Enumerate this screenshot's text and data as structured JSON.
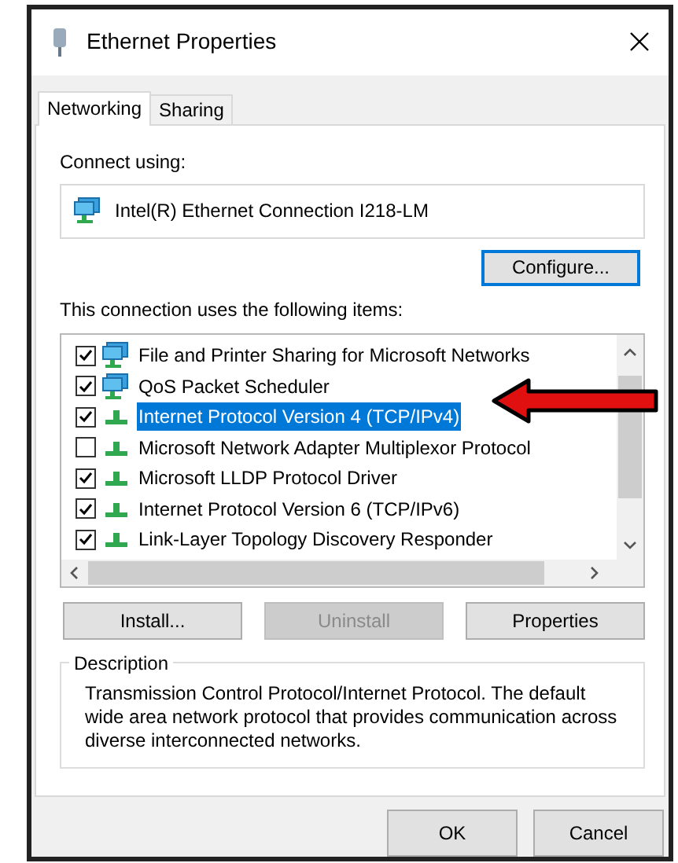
{
  "window": {
    "title": "Ethernet Properties"
  },
  "tabs": [
    {
      "label": "Networking",
      "selected": true
    },
    {
      "label": "Sharing",
      "selected": false
    }
  ],
  "connect_using": {
    "label": "Connect using:",
    "adapter": "Intel(R) Ethernet Connection I218-LM",
    "configure_button": "Configure..."
  },
  "items_label": "This connection uses the following items:",
  "items": [
    {
      "kind": "service",
      "label": "File and Printer Sharing for Microsoft Networks",
      "checked": true,
      "selected": false
    },
    {
      "kind": "service",
      "label": "QoS Packet Scheduler",
      "checked": true,
      "selected": false
    },
    {
      "kind": "protocol",
      "label": "Internet Protocol Version 4 (TCP/IPv4)",
      "checked": true,
      "selected": true
    },
    {
      "kind": "protocol",
      "label": "Microsoft Network Adapter Multiplexor Protocol",
      "checked": false,
      "selected": false
    },
    {
      "kind": "protocol",
      "label": "Microsoft LLDP Protocol Driver",
      "checked": true,
      "selected": false
    },
    {
      "kind": "protocol",
      "label": "Internet Protocol Version 6 (TCP/IPv6)",
      "checked": true,
      "selected": false
    },
    {
      "kind": "protocol",
      "label": "Link-Layer Topology Discovery Responder",
      "checked": true,
      "selected": false
    }
  ],
  "item_buttons": [
    {
      "label": "Install...",
      "disabled": false
    },
    {
      "label": "Uninstall",
      "disabled": true
    },
    {
      "label": "Properties",
      "disabled": false
    }
  ],
  "description": {
    "legend": "Description",
    "text": "Transmission Control Protocol/Internet Protocol. The default wide area network protocol that provides communication across diverse interconnected networks."
  },
  "dialog_buttons": [
    "OK",
    "Cancel"
  ]
}
